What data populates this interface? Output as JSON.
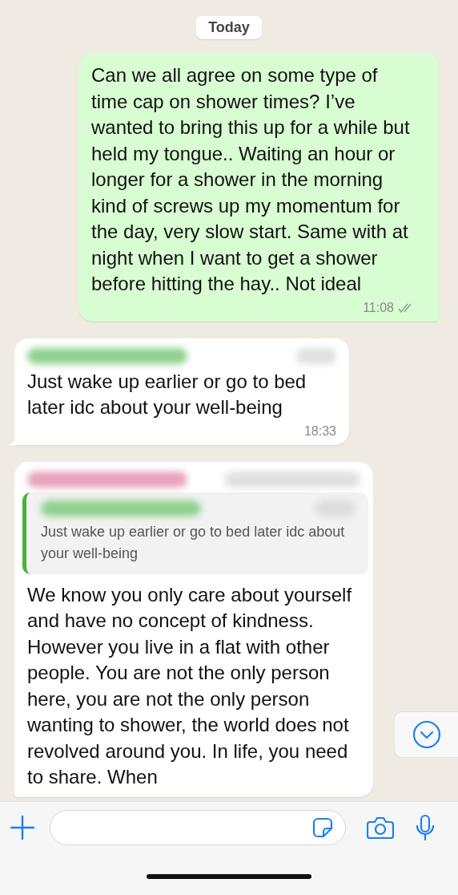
{
  "date_separator": "Today",
  "messages": [
    {
      "kind": "outgoing",
      "text": "Can we all agree on some type of time cap on shower times? I’ve wanted to bring this up for a while but held my tongue.. Waiting an hour or longer for a shower in the morning kind of screws up my momentum for the day, very slow start. Same with at night when I want to get a shower before hitting the hay.. Not ideal",
      "time": "11:08",
      "read": false
    },
    {
      "kind": "incoming",
      "color": "#8fd18f",
      "text": "Just wake up earlier or go to bed later idc about your well-being",
      "time": "18:33"
    },
    {
      "kind": "reply",
      "color": "#e9a3bd",
      "quote": {
        "color": "#8fd18f",
        "text": "Just wake up earlier or go to bed later idc about your well-being"
      },
      "text": "We know you only care about yourself and have no concept of kindness. However you live in a flat with other people. You are not the only person here, you are not the only person wanting to shower, the world does not revolved around you. In life, you need to share. When"
    }
  ]
}
